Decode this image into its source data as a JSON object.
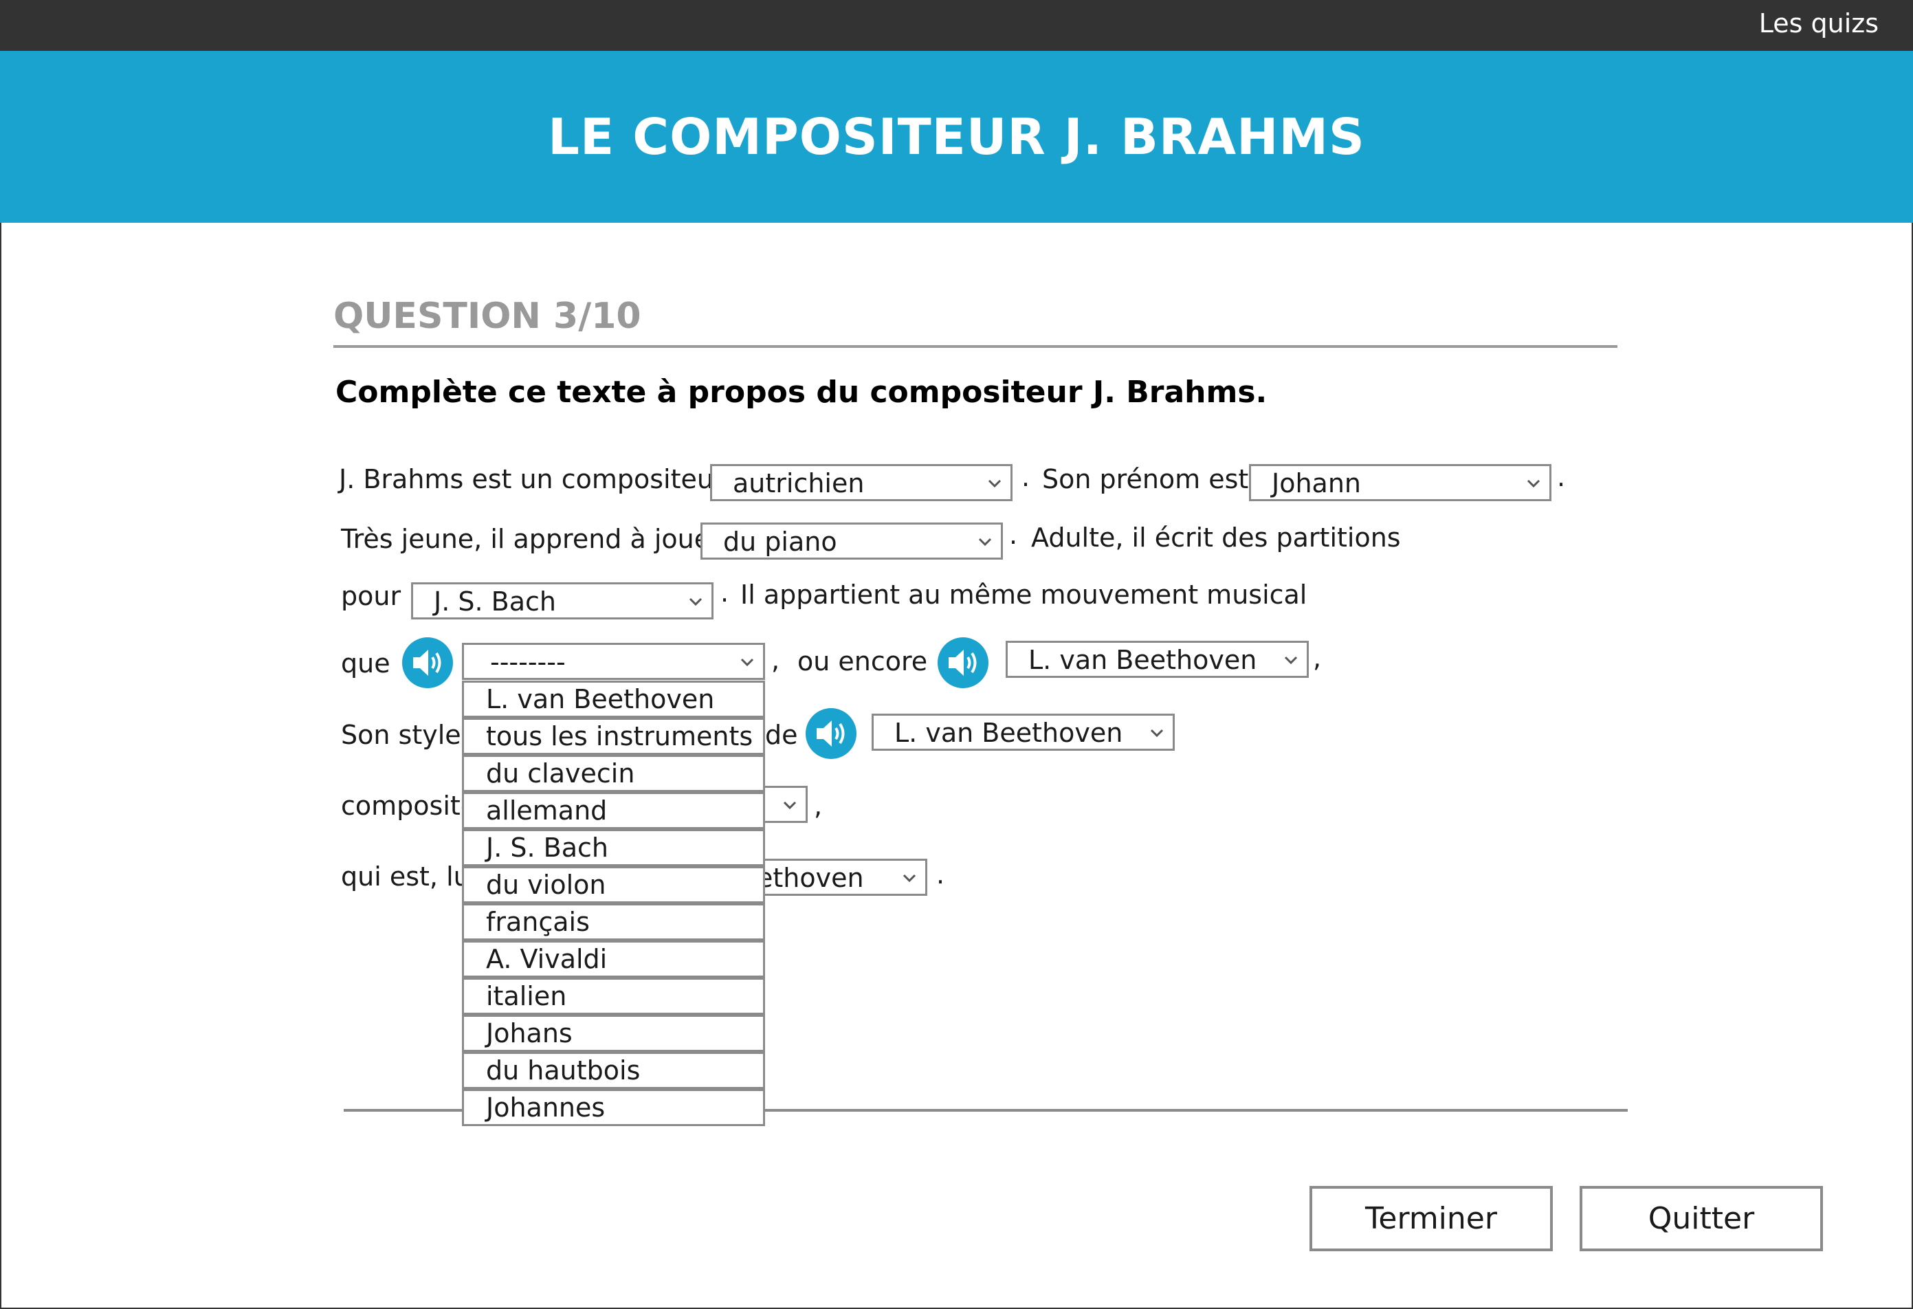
{
  "topbar": {
    "link": "Les quizs"
  },
  "header": {
    "title": "LE COMPOSITEUR J. BRAHMS"
  },
  "question": {
    "label": "QUESTION 3/10",
    "instruction": "Complète ce texte à propos du compositeur J. Brahms."
  },
  "text": {
    "t1": "J. Brahms est un compositeur",
    "t2": ".",
    "t3": "Son prénom est",
    "t4": ".",
    "t5": "Très jeune, il apprend à jouer",
    "t6": ".",
    "t7": "Adulte, il écrit des partitions",
    "t8": "pour",
    "t9": ".",
    "t10": "Il appartient au même mouvement musical",
    "t11": "que",
    "t12": ",",
    "t13": "ou encore",
    "t14": ",",
    "t15": "Son style r",
    "t16": "de",
    "t17": "composite",
    "t18": ",",
    "t19": "qui est, lui",
    "t20": "."
  },
  "selects": {
    "s1": "autrichien",
    "s2": "Johann",
    "s3": "du piano",
    "s4": "J. S. Bach",
    "s5": "--------",
    "s6": "L. van Beethoven",
    "s7": "L. van Beethoven",
    "s9": "ethoven"
  },
  "dropdown_options": [
    "L. van Beethoven",
    "tous les instruments",
    "du clavecin",
    "allemand",
    "J. S. Bach",
    "du violon",
    "français",
    "A. Vivaldi",
    "italien",
    "Johans",
    "du hautbois",
    "Johannes"
  ],
  "buttons": {
    "finish": "Terminer",
    "quit": "Quitter"
  },
  "icons": {
    "speaker": "speaker-icon",
    "chevron": "chevron-down-icon"
  },
  "colors": {
    "accent": "#1aa3cf",
    "topbar": "#333333",
    "muted": "#999999"
  }
}
